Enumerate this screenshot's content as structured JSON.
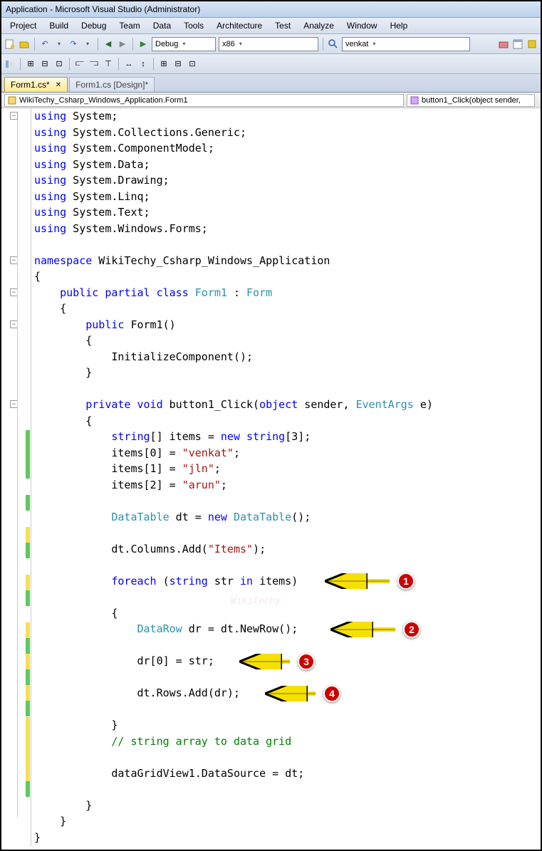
{
  "title": "Application - Microsoft Visual Studio (Administrator)",
  "menu": {
    "project": "Project",
    "build": "Build",
    "debug": "Debug",
    "team": "Team",
    "data": "Data",
    "tools": "Tools",
    "architecture": "Architecture",
    "test": "Test",
    "analyze": "Analyze",
    "window": "Window",
    "help": "Help"
  },
  "toolbar": {
    "config": "Debug",
    "platform": "x86",
    "extra": "venkat"
  },
  "tabs": {
    "active": "Form1.cs*",
    "inactive": "Form1.cs [Design]*"
  },
  "nav": {
    "left": "WikiTechy_Csharp_Windows_Application.Form1",
    "right": "button1_Click(object sender,"
  },
  "annotations": {
    "a1": "1",
    "a2": "2",
    "a3": "3",
    "a4": "4"
  },
  "code": {
    "l1": "using",
    "l1b": " System;",
    "l2": "using",
    "l2b": " System.Collections.Generic;",
    "l3": "using",
    "l3b": " System.ComponentModel;",
    "l4": "using",
    "l4b": " System.Data;",
    "l5": "using",
    "l5b": " System.Drawing;",
    "l6": "using",
    "l6b": " System.Linq;",
    "l7": "using",
    "l7b": " System.Text;",
    "l8": "using",
    "l8b": " System.Windows.Forms;",
    "ns": "namespace",
    "nsb": " WikiTechy_Csharp_Windows_Application",
    "ob": "{",
    "pub": "public",
    "partial": "partial",
    "class": "class",
    "form1": "Form1",
    "colon": " : ",
    "form": "Form",
    "ctor_pub": "public",
    "ctor_name": " Form1()",
    "init": "            InitializeComponent();",
    "priv": "private",
    "void_kw": "void",
    "btn": " button1_Click(",
    "obj": "object",
    "sender": " sender, ",
    "ea": "EventArgs",
    "e": " e)",
    "str_kw": "string",
    "items_decl": "[] items = ",
    "new_kw": "new",
    "str_kw2": "string",
    "arr3": "[3];",
    "items0": "            items[0] = ",
    "venkat": "\"venkat\"",
    "semi": ";",
    "items1": "            items[1] = ",
    "jln": "\"jln\"",
    "items2": "            items[2] = ",
    "arun": "\"arun\"",
    "dt_type": "DataTable",
    "dt_decl": " dt = ",
    "new_kw2": "new",
    "dt_type2": "DataTable",
    "dt_paren": "();",
    "coladd": "            dt.Columns.Add(",
    "items_str": "\"Items\"",
    "cparen": ");",
    "foreach_kw": "foreach",
    "fe_open": " (",
    "str_kw3": "string",
    "str_var": " str ",
    "in_kw": "in",
    "in_items": " items)",
    "dr_type": "DataRow",
    "dr_decl": " dr = dt.NewRow();",
    "dr0": "                dr[0] = str;",
    "rowadd": "                dt.Rows.Add(dr);",
    "comment": "// string array to data grid",
    "dgv": "            dataGridView1.DataSource = dt;",
    "cb": "}"
  },
  "watermark": "Wikitechy"
}
